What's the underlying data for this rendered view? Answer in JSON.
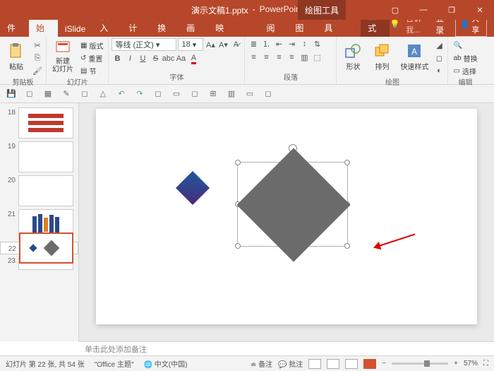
{
  "titlebar": {
    "filename": "演示文稿1.pptx",
    "appname": "PowerPoint",
    "tooltab": "绘图工具"
  },
  "tabs": {
    "file": "文件",
    "home": "开始",
    "islide": "iSlide",
    "insert": "插入",
    "design": "设计",
    "transition": "切换",
    "animation": "动画",
    "slideshow": "幻灯片放映",
    "review": "审阅",
    "view": "视图",
    "developer": "开发工具",
    "format": "格式",
    "tellme": "告诉我...",
    "signin": "登录",
    "share": "共享"
  },
  "ribbon": {
    "clipboard": {
      "label": "剪贴板",
      "paste": "粘贴"
    },
    "slides": {
      "label": "幻灯片",
      "newslide": "新建\n幻灯片",
      "layout": "版式",
      "reset": "重置",
      "section": "节"
    },
    "font": {
      "label": "字体",
      "family": "等线 (正文)",
      "size": "18",
      "bold": "B",
      "italic": "I",
      "underline": "U",
      "strike": "S",
      "shadow": "abc",
      "spacing": "Aa"
    },
    "paragraph": {
      "label": "段落"
    },
    "drawing": {
      "label": "绘图",
      "shapes": "形状",
      "arrange": "排列",
      "quickstyle": "快速样式"
    },
    "editing": {
      "label": "编辑",
      "replace": "替换",
      "select": "选择"
    }
  },
  "thumbs": {
    "n18": "18",
    "n19": "19",
    "n20": "20",
    "n21": "21",
    "n22": "22",
    "n23": "23"
  },
  "notes": {
    "placeholder": "单击此处添加备注"
  },
  "status": {
    "slideinfo": "幻灯片 第 22 张, 共 54 张",
    "theme": "\"Office 主题\"",
    "lang": "中文(中国)",
    "notes": "备注",
    "comments": "批注",
    "zoom": "57%"
  }
}
